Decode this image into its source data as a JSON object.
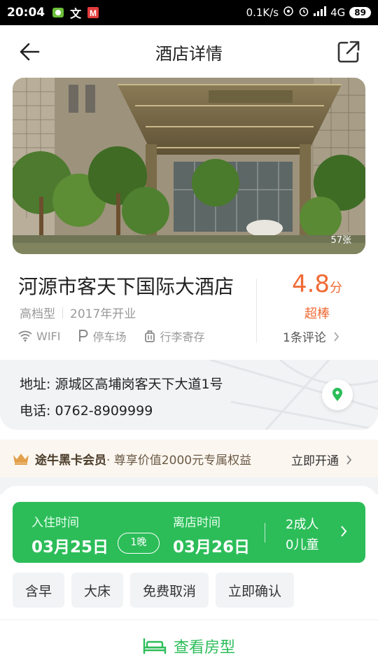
{
  "status_bar": {
    "time": "20:04",
    "network_speed": "0.1K/s",
    "signal": "4G",
    "battery": "89"
  },
  "nav": {
    "title": "酒店详情"
  },
  "gallery": {
    "photo_count": "57张"
  },
  "hotel": {
    "name": "河源市客天下国际大酒店",
    "grade": "高档型",
    "opened": "2017年开业",
    "facilities": [
      {
        "icon": "wifi-icon",
        "label": "WIFI"
      },
      {
        "icon": "parking-icon",
        "label": "停车场"
      },
      {
        "icon": "luggage-icon",
        "label": "行李寄存"
      }
    ],
    "score": "4.8",
    "score_unit": "分",
    "score_label": "超棒",
    "reviews": "1条评论"
  },
  "contact": {
    "address_key": "地址:",
    "address_value": "源城区高埔岗客天下大道1号",
    "phone_key": "电话:",
    "phone_value": "0762-8909999"
  },
  "membership": {
    "title": "途牛黑卡会员",
    "subtitle": "· 尊享价值2000元专属权益",
    "cta": "立即开通"
  },
  "booking": {
    "checkin_label": "入住时间",
    "checkin_date": "03月25日",
    "nights": "1晚",
    "checkout_label": "离店时间",
    "checkout_date": "03月26日",
    "adults": "2成人",
    "children": "0儿童"
  },
  "filters": [
    "含早",
    "大床",
    "免费取消",
    "立即确认"
  ],
  "bottom_bar": {
    "label": "查看房型"
  },
  "colors": {
    "brand_green": "#2cbd59",
    "score_orange": "#f06a35",
    "member_gold": "#e2a04a"
  }
}
